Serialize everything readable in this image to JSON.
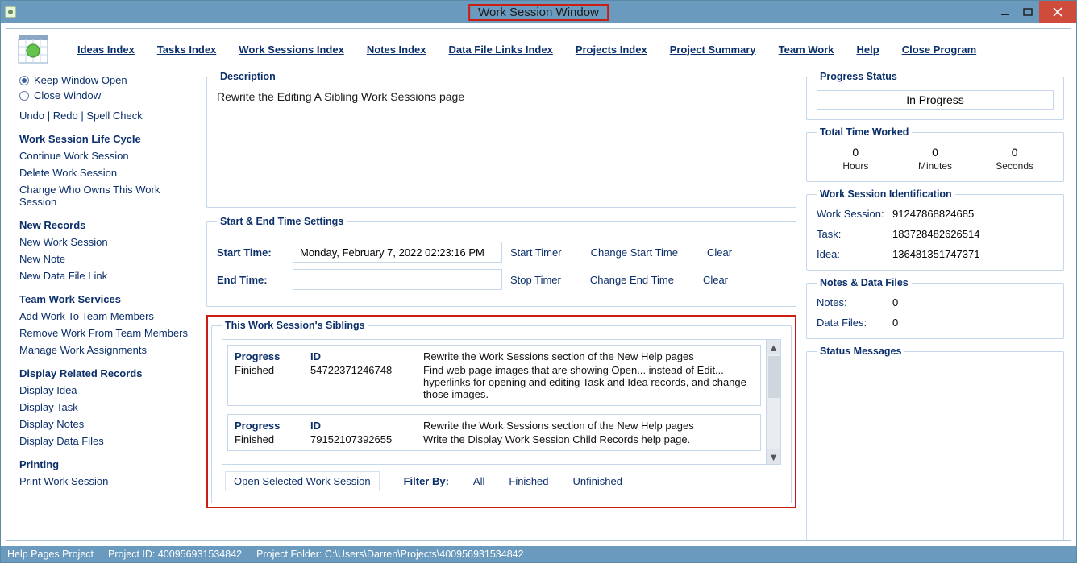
{
  "window": {
    "title": "Work Session Window"
  },
  "topmenu": {
    "items": [
      "Ideas Index",
      "Tasks Index",
      "Work Sessions Index",
      "Notes Index",
      "Data File Links Index",
      "Projects Index",
      "Project Summary",
      "Team Work",
      "Help",
      "Close Program"
    ]
  },
  "left": {
    "radio_keep": "Keep Window Open",
    "radio_close": "Close Window",
    "undo": "Undo",
    "redo": "Redo",
    "spell": "Spell Check",
    "sec_lifecycle": "Work Session Life Cycle",
    "lc1": "Continue Work Session",
    "lc2": "Delete Work Session",
    "lc3": "Change Who Owns This Work Session",
    "sec_new": "New Records",
    "nr1": "New Work Session",
    "nr2": "New Note",
    "nr3": "New Data File Link",
    "sec_team": "Team Work Services",
    "tw1": "Add Work To Team Members",
    "tw2": "Remove Work From Team Members",
    "tw3": "Manage Work Assignments",
    "sec_display": "Display Related Records",
    "d1": "Display Idea",
    "d2": "Display Task",
    "d3": "Display Notes",
    "d4": "Display Data Files",
    "sec_print": "Printing",
    "p1": "Print Work Session"
  },
  "center": {
    "desc_legend": "Description",
    "desc_text": "Rewrite the Editing A Sibling Work Sessions page",
    "time_legend": "Start & End Time Settings",
    "start_label": "Start Time:",
    "start_value": "Monday, February 7, 2022  02:23:16 PM",
    "start_timer": "Start Timer",
    "change_start": "Change Start Time",
    "clear_start": "Clear",
    "end_label": "End Time:",
    "end_value": "",
    "stop_timer": "Stop Timer",
    "change_end": "Change End Time",
    "clear_end": "Clear",
    "siblings_legend": "This Work Session's Siblings",
    "col_progress": "Progress",
    "col_id": "ID",
    "siblings": [
      {
        "progress": "Finished",
        "id": "54722371246748",
        "line1": "Rewrite the Work Sessions section of the New Help pages",
        "line2": "Find web page images that are showing Open... instead of Edit... hyperlinks for opening and editing Task and Idea records, and change those images."
      },
      {
        "progress": "Finished",
        "id": "79152107392655",
        "line1": "Rewrite the Work Sessions section of the New Help pages",
        "line2": "Write the Display Work Session Child Records help page."
      }
    ],
    "open_selected": "Open Selected Work Session",
    "filter_by": "Filter By:",
    "filter_all": "All",
    "filter_fin": "Finished",
    "filter_unfin": "Unfinished"
  },
  "right": {
    "ps_legend": "Progress Status",
    "ps_value": "In Progress",
    "ttw_legend": "Total Time Worked",
    "hours": "0",
    "minutes": "0",
    "seconds": "0",
    "hours_l": "Hours",
    "minutes_l": "Minutes",
    "seconds_l": "Seconds",
    "wsid_legend": "Work Session Identification",
    "ws_label": "Work Session:",
    "ws_val": "91247868824685",
    "task_label": "Task:",
    "task_val": "183728482626514",
    "idea_label": "Idea:",
    "idea_val": "136481351747371",
    "notes_legend": "Notes & Data Files",
    "notes_label": "Notes:",
    "notes_val": "0",
    "df_label": "Data Files:",
    "df_val": "0",
    "status_legend": "Status Messages"
  },
  "statusbar": {
    "s1": "Help Pages Project",
    "s2": "Project ID: 400956931534842",
    "s3": "Project Folder: C:\\Users\\Darren\\Projects\\400956931534842"
  }
}
